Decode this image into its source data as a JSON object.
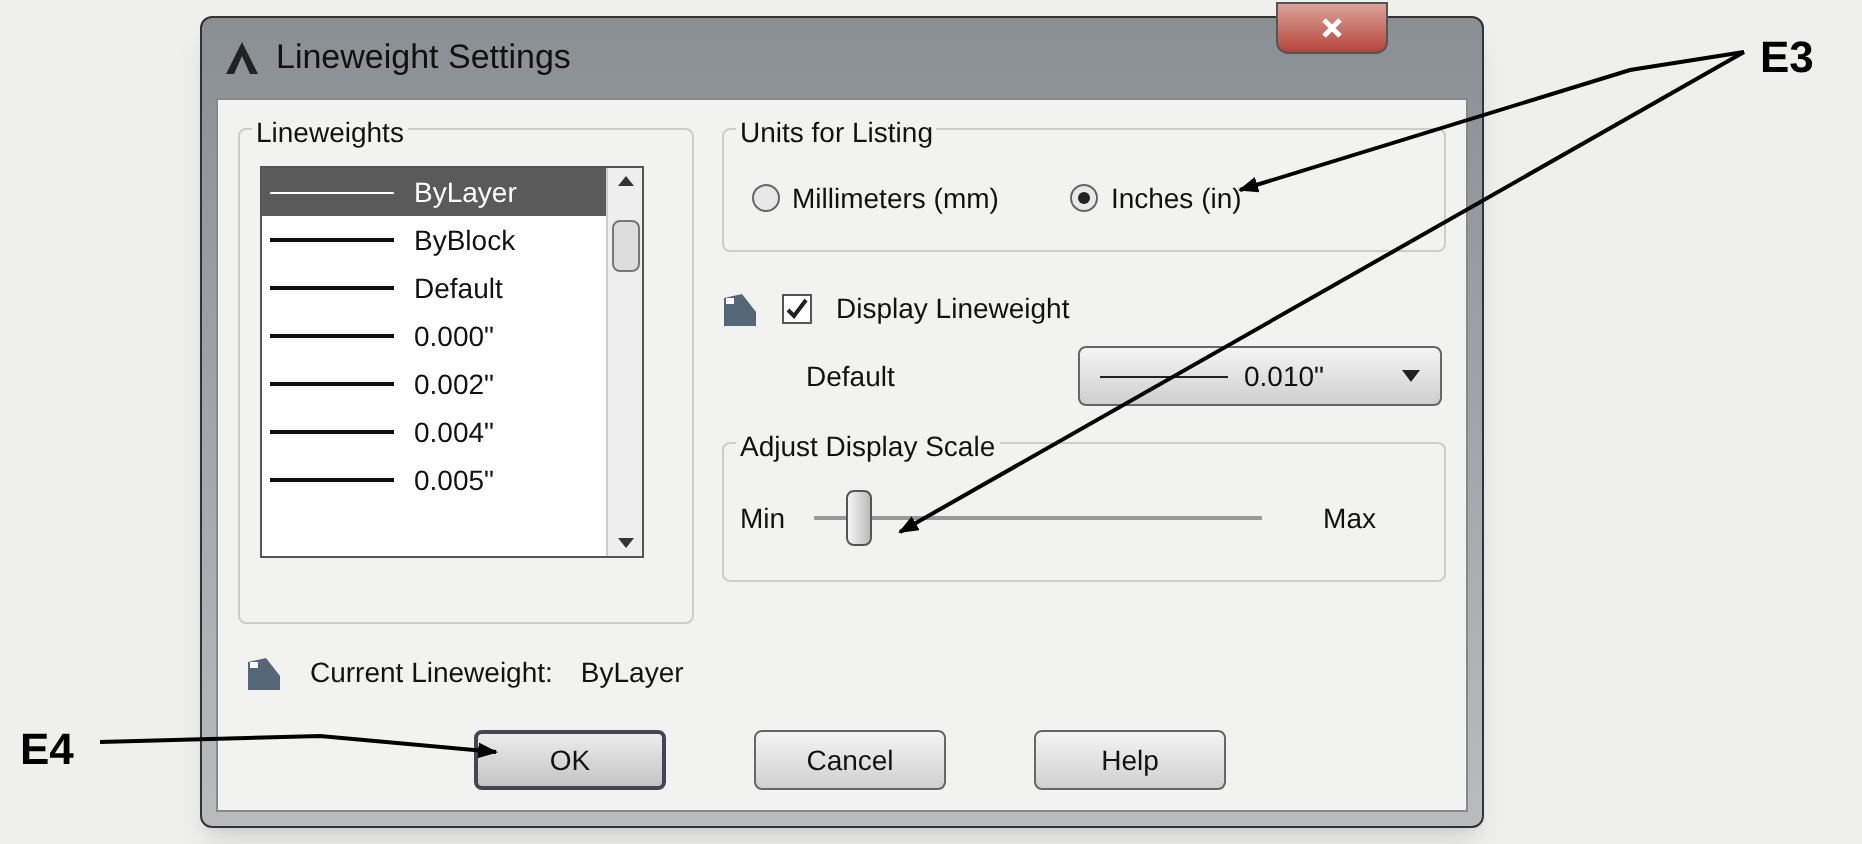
{
  "window": {
    "title": "Lineweight Settings"
  },
  "lineweights": {
    "label": "Lineweights",
    "items": [
      {
        "label": "ByLayer",
        "selected": true
      },
      {
        "label": "ByBlock",
        "selected": false
      },
      {
        "label": "Default",
        "selected": false
      },
      {
        "label": "0.000\"",
        "selected": false
      },
      {
        "label": "0.002\"",
        "selected": false
      },
      {
        "label": "0.004\"",
        "selected": false
      },
      {
        "label": "0.005\"",
        "selected": false
      }
    ]
  },
  "units": {
    "label": "Units for Listing",
    "options": [
      {
        "label": "Millimeters (mm)",
        "selected": false
      },
      {
        "label": "Inches (in)",
        "selected": true
      }
    ]
  },
  "display_lineweight": {
    "label": "Display Lineweight",
    "checked": true
  },
  "default": {
    "label": "Default",
    "value": "0.010\""
  },
  "scale": {
    "label": "Adjust Display Scale",
    "min_label": "Min",
    "max_label": "Max",
    "level": 0.1
  },
  "current": {
    "label": "Current Lineweight:",
    "value": "ByLayer"
  },
  "buttons": [
    {
      "label": "OK",
      "default": true
    },
    {
      "label": "Cancel",
      "default": false
    },
    {
      "label": "Help",
      "default": false
    }
  ],
  "callouts": [
    {
      "label": "E3"
    },
    {
      "label": "E4"
    }
  ]
}
